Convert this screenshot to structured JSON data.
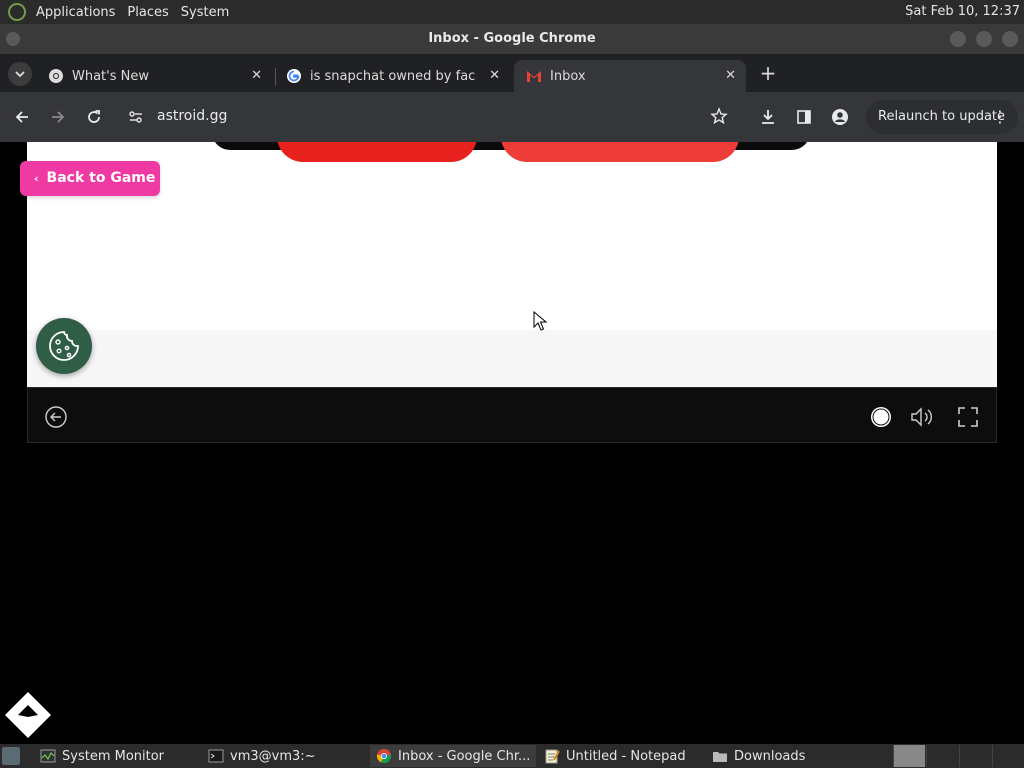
{
  "top_panel": {
    "menus": [
      "Applications",
      "Places",
      "System"
    ],
    "clock": "Sat Feb 10, 12:37"
  },
  "window": {
    "title": "Inbox - Google Chrome"
  },
  "tabs": [
    {
      "title": "What's New",
      "icon": "chrome-icon"
    },
    {
      "title": "is snapchat owned by facebook",
      "icon": "google-icon"
    },
    {
      "title": "Inbox",
      "icon": "gmail-icon",
      "active": true
    }
  ],
  "toolbar": {
    "url": "astroid.gg",
    "relaunch_label": "Relaunch to update"
  },
  "page": {
    "back_label": "Back to Game",
    "colors": {
      "back_button": "#f03aa3",
      "cookie_button": "#2f5d45",
      "red_primary": "#e8211f",
      "red_secondary": "#ee3d38"
    }
  },
  "taskbar": {
    "items": [
      {
        "label": "System Monitor",
        "icon": "system-monitor-icon"
      },
      {
        "label": "vm3@vm3:~",
        "icon": "terminal-icon"
      },
      {
        "label": "Inbox - Google Chr...",
        "icon": "chrome-icon",
        "active": true
      },
      {
        "label": "Untitled - Notepad",
        "icon": "notepad-icon"
      },
      {
        "label": "Downloads",
        "icon": "folder-icon"
      }
    ]
  }
}
